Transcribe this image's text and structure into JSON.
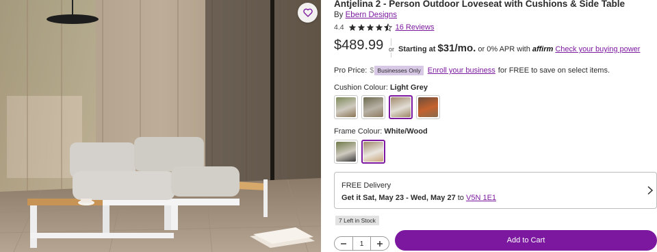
{
  "product": {
    "title": "Antjelina 2 - Person Outdoor Loveseat with Cushions & Side Table",
    "by_prefix": "By",
    "brand": "Ebern Designs",
    "rating": "4.4",
    "rating_value": 4.4,
    "rating_max": 5,
    "reviews_label": "16 Reviews",
    "image_alt_icon": "favorite-heart-icon"
  },
  "pricing": {
    "price": "$489.99",
    "or_label": "or",
    "starting_prefix": "Starting at",
    "monthly": "$31/mo.",
    "apr_text": "or 0% APR with",
    "affirm_brand": "affirm",
    "buying_power_link": "Check your buying power"
  },
  "pro": {
    "label": "Pro Price:",
    "hidden_price_prefix": "$",
    "badge": "Businesses Only",
    "enroll_link": "Enroll your business",
    "tail": "for FREE to save on select items."
  },
  "cushion": {
    "label": "Cushion Colour:",
    "selected": "Light Grey",
    "selected_index": 2
  },
  "frame": {
    "label": "Frame Colour:",
    "selected": "White/Wood",
    "selected_index": 1
  },
  "delivery": {
    "title": "FREE Delivery",
    "get_it": "Get it Sat, May 23 - Wed, May 27",
    "to_label": "to",
    "postal_code": "V5N 1E1"
  },
  "stock": {
    "label": "7 Left in Stock"
  },
  "quantity": {
    "value": "1"
  },
  "actions": {
    "add_to_cart": "Add to Cart"
  },
  "colors": {
    "accent": "#7b189f",
    "badge_bg": "#d7c8e6"
  }
}
